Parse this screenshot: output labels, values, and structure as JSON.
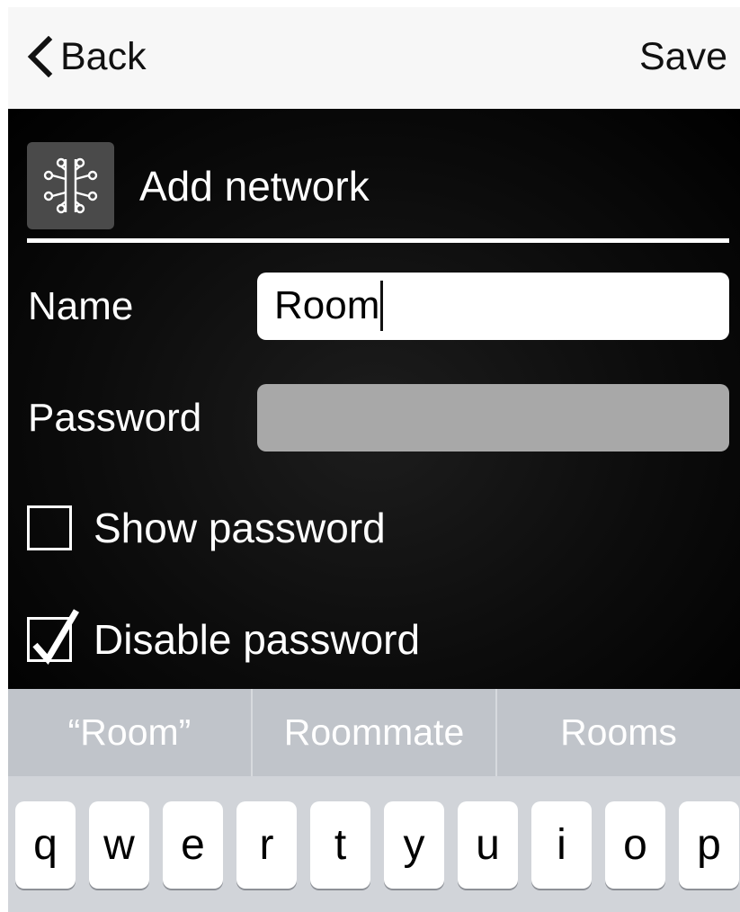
{
  "nav": {
    "back_label": "Back",
    "save_label": "Save"
  },
  "header": {
    "title": "Add network",
    "icon": "network-tree-icon"
  },
  "form": {
    "name_label": "Name",
    "name_value": "Room",
    "password_label": "Password",
    "password_value": "",
    "show_password_label": "Show password",
    "show_password_checked": false,
    "disable_password_label": "Disable password",
    "disable_password_checked": true
  },
  "predictions": [
    "“Room”",
    "Roommate",
    "Rooms"
  ],
  "keyboard": {
    "row1": [
      "q",
      "w",
      "e",
      "r",
      "t",
      "y",
      "u",
      "i",
      "o",
      "p"
    ]
  },
  "colors": {
    "panel_background": "#000000",
    "nav_background": "#f7f7f7",
    "predict_bar": "#c0c4ca",
    "keyboard_background": "#d1d4d9",
    "password_field_disabled": "#a8a8a8"
  }
}
